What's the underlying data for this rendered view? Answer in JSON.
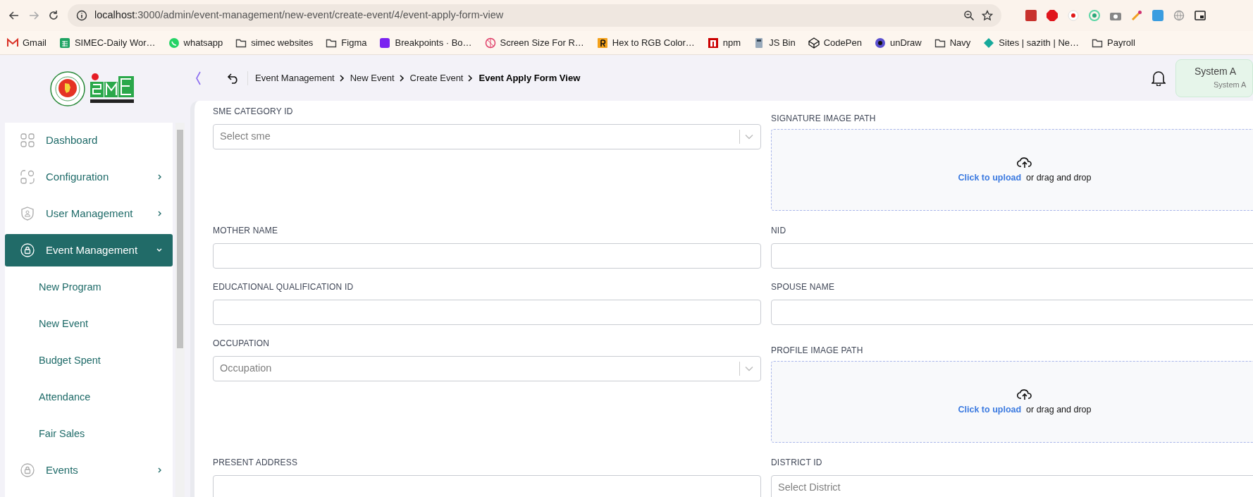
{
  "browser": {
    "url_host": "localhost",
    "url_path": ":3000/admin/event-management/new-event/create-event/4/event-apply-form-view",
    "bookmarks": [
      {
        "label": "Gmail",
        "kind": "mail"
      },
      {
        "label": "SIMEC-Daily Wor…",
        "kind": "sheet"
      },
      {
        "label": "whatsapp",
        "kind": "chat"
      },
      {
        "label": "simec websites",
        "kind": "folder"
      },
      {
        "label": "Figma",
        "kind": "folder"
      },
      {
        "label": "Breakpoints · Bo…",
        "kind": "square-purple"
      },
      {
        "label": "Screen Size For R…",
        "kind": "ball"
      },
      {
        "label": "Hex to RGB Color…",
        "kind": "square-orange"
      },
      {
        "label": "npm",
        "kind": "square-red"
      },
      {
        "label": "JS Bin",
        "kind": "bin"
      },
      {
        "label": "CodePen",
        "kind": "cube"
      },
      {
        "label": "unDraw",
        "kind": "disc"
      },
      {
        "label": "Navy",
        "kind": "folder"
      },
      {
        "label": "Sites | sazith | Ne…",
        "kind": "diamond"
      },
      {
        "label": "Payroll",
        "kind": "folder"
      }
    ]
  },
  "sidebar": {
    "items": [
      {
        "label": "Dashboard",
        "kind": "link",
        "selected": false
      },
      {
        "label": "Configuration",
        "kind": "group",
        "expanded": false,
        "selected": false
      },
      {
        "label": "User Management",
        "kind": "group",
        "expanded": false,
        "selected": false
      },
      {
        "label": "Event Management",
        "kind": "group",
        "expanded": true,
        "selected": true,
        "children": [
          {
            "label": "New Program",
            "selected": false
          },
          {
            "label": "New Event",
            "selected": false
          },
          {
            "label": "Budget Spent",
            "selected": false
          },
          {
            "label": "Attendance",
            "selected": false
          },
          {
            "label": "Fair Sales",
            "selected": false
          }
        ]
      },
      {
        "label": "Events",
        "kind": "group",
        "expanded": false,
        "selected": false
      }
    ]
  },
  "header": {
    "breadcrumb": [
      {
        "label": "Event Management",
        "current": false
      },
      {
        "label": "New Event",
        "current": false
      },
      {
        "label": "Create Event",
        "current": false
      },
      {
        "label": "Event Apply Form View",
        "current": true
      }
    ],
    "user": {
      "name": "System A",
      "role": "System A"
    }
  },
  "form": {
    "rows": [
      [
        {
          "label": "SME CATEGORY ID",
          "kind": "select",
          "placeholder": "Select sme"
        },
        {
          "label": "SIGNATURE IMAGE PATH",
          "kind": "upload",
          "link": "Click to upload",
          "hint": "or drag and drop"
        }
      ],
      [
        {
          "label": "MOTHER NAME",
          "kind": "text"
        },
        {
          "label": "NID",
          "kind": "text"
        }
      ],
      [
        {
          "label": "EDUCATIONAL QUALIFICATION ID",
          "kind": "text"
        },
        {
          "label": "SPOUSE NAME",
          "kind": "text"
        }
      ],
      [
        {
          "label": "OCCUPATION",
          "kind": "select",
          "placeholder": "Occupation"
        },
        {
          "label": "PROFILE IMAGE PATH",
          "kind": "upload",
          "link": "Click to upload",
          "hint": "or drag and drop"
        }
      ],
      [
        {
          "label": "PRESENT ADDRESS",
          "kind": "text"
        },
        {
          "label": "DISTRICT ID",
          "kind": "select",
          "placeholder": "Select District"
        }
      ]
    ]
  }
}
